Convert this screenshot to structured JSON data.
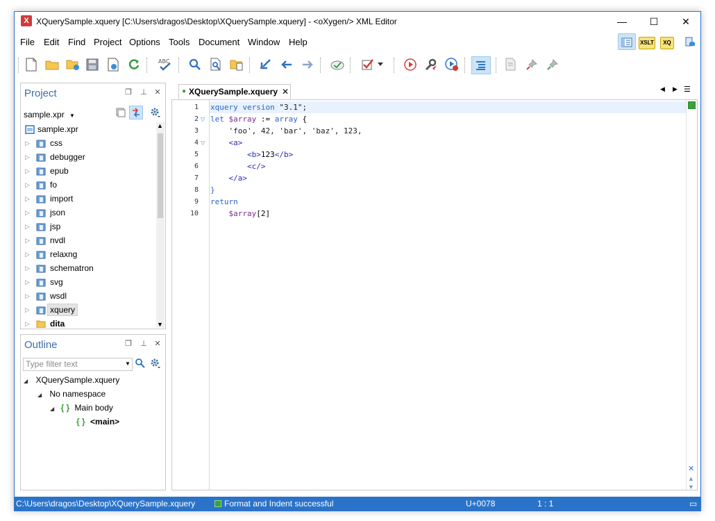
{
  "window": {
    "title": "XQuerySample.xquery [C:\\Users\\dragos\\Desktop\\XQuerySample.xquery] - <oXygen/> XML Editor",
    "minimize": "—",
    "maximize": "☐",
    "close": "✕"
  },
  "menu": {
    "items": [
      "File",
      "Edit",
      "Find",
      "Project",
      "Options",
      "Tools",
      "Document",
      "Window",
      "Help"
    ]
  },
  "perspectives": [
    "XSLT",
    "XQ"
  ],
  "project_panel": {
    "title": "Project",
    "project_file": "sample.xpr",
    "root": "sample.xpr",
    "folders": [
      "css",
      "debugger",
      "epub",
      "fo",
      "import",
      "json",
      "jsp",
      "nvdl",
      "relaxng",
      "schematron",
      "svg",
      "wsdl",
      "xquery",
      "dita"
    ],
    "selected": "xquery"
  },
  "outline_panel": {
    "title": "Outline",
    "filter_placeholder": "Type filter text",
    "nodes": [
      {
        "label": "XQuerySample.xquery"
      },
      {
        "label": "No namespace"
      },
      {
        "icon": "{ }",
        "label": "Main body"
      },
      {
        "icon": "{ }",
        "label": "<main>"
      }
    ]
  },
  "editor": {
    "tab_label": "XQuerySample.xquery",
    "line_numbers": [
      "1",
      "2",
      "3",
      "4",
      "5",
      "6",
      "7",
      "8",
      "9",
      "10"
    ],
    "code": {
      "l1_kw": "xquery version",
      "l1_str": " \"3.1\";",
      "l2_kw1": "let",
      "l2_var": " $array",
      "l2_op": " :=",
      "l2_kw2": " array",
      "l2_rest": " {",
      "l3": "    'foo', 42, 'bar', 'baz', 123,",
      "l4": "    <a>",
      "l5_open": "        <b>",
      "l5_text": "123",
      "l5_close": "</b>",
      "l6": "        <c/>",
      "l7": "    </a>",
      "l8": "}",
      "l9": "return",
      "l10_var": "    $array",
      "l10_rest": "[2]"
    }
  },
  "status": {
    "path": "C:\\Users\\dragos\\Desktop\\XQuerySample.xquery",
    "message": "Format and Indent successful",
    "unicode": "U+0078",
    "position": "1 : 1"
  },
  "colors": {
    "accent": "#2b73c8",
    "keyword": "#2b63c6",
    "variable": "#7b2c8c",
    "tag": "#2b2bb8",
    "success": "#3ca03c"
  }
}
